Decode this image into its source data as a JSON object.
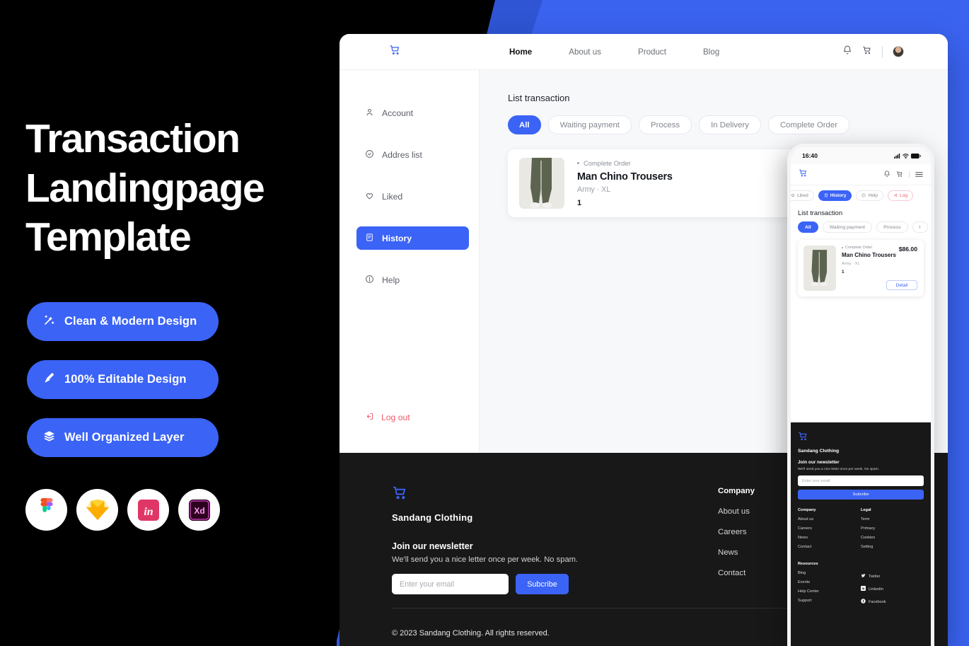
{
  "promo": {
    "title": "Transaction Landingpage Template",
    "badges": [
      {
        "label": "Clean & Modern  Design",
        "icon": "magic-wand-icon"
      },
      {
        "label": "100% Editable Design",
        "icon": "pen-nib-icon"
      },
      {
        "label": "Well Organized Layer",
        "icon": "layers-icon"
      }
    ],
    "apps": [
      {
        "name": "figma-icon",
        "label": "Figma"
      },
      {
        "name": "sketch-icon",
        "label": "Sketch"
      },
      {
        "name": "invision-icon",
        "label": "InVision"
      },
      {
        "name": "adobe-xd-icon",
        "label": "Xd"
      }
    ]
  },
  "colors": {
    "accent": "#3b63f6",
    "bg_blue_bright": "#3a63f0",
    "bg_blue_dark": "#2f55d4",
    "footer_dark": "#181818",
    "danger": "#ef5a6a"
  },
  "desktop": {
    "navbar": {
      "logo": "shopping-cart-icon",
      "links": [
        {
          "label": "Home",
          "active": true
        },
        {
          "label": "About us",
          "active": false
        },
        {
          "label": "Product",
          "active": false
        },
        {
          "label": "Blog",
          "active": false
        }
      ],
      "bell": "bell-icon",
      "cart": "cart-icon",
      "avatar": "user-avatar"
    },
    "sidebar": {
      "items": [
        {
          "label": "Account",
          "icon": "user-icon",
          "active": false
        },
        {
          "label": "Addres list",
          "icon": "check-circle-icon",
          "active": false
        },
        {
          "label": "Liked",
          "icon": "heart-icon",
          "active": false
        },
        {
          "label": "History",
          "icon": "receipt-icon",
          "active": true
        },
        {
          "label": "Help",
          "icon": "info-circle-icon",
          "active": false
        }
      ],
      "logout": "Log out"
    },
    "main": {
      "title": "List transaction",
      "filters": [
        {
          "label": "All",
          "active": true
        },
        {
          "label": "Waiting payment",
          "active": false
        },
        {
          "label": "Process",
          "active": false
        },
        {
          "label": "In Delivery",
          "active": false
        },
        {
          "label": "Complete Order",
          "active": false
        }
      ],
      "transaction": {
        "status": "Complete Order",
        "name": "Man Chino Trousers",
        "variant": "Army · XL",
        "quantity": "1"
      }
    },
    "footer": {
      "logo": "shopping-cart-icon",
      "brand": "Sandang Clothing",
      "newsletter_title": "Join our newsletter",
      "newsletter_sub": "We'll send you a nice letter once per week. No spam.",
      "email_placeholder": "Enter your email",
      "subscribe_label": "Subcribe",
      "column": {
        "heading": "Company",
        "links": [
          "About us",
          "Careers",
          "News",
          "Contact"
        ]
      },
      "copyright": "© 2023 Sandang Clothing. All rights reserved."
    }
  },
  "phone": {
    "status_bar": {
      "time": "16:40",
      "signal": "signal-icon",
      "wifi": "wifi-icon",
      "battery": "battery-icon"
    },
    "navbar": {
      "logo": "shopping-cart-icon",
      "bell": "bell-icon",
      "cart": "cart-icon",
      "menu": "hamburger-menu-icon"
    },
    "nav_chips": [
      {
        "label": "Liked",
        "icon": "heart-icon",
        "active": false,
        "danger": false
      },
      {
        "label": "History",
        "icon": "receipt-icon",
        "active": true,
        "danger": false
      },
      {
        "label": "Help",
        "icon": "info-circle-icon",
        "active": false,
        "danger": false
      },
      {
        "label": "Log",
        "icon": "logout-icon",
        "active": false,
        "danger": true
      }
    ],
    "main": {
      "title": "List transaction",
      "filters": [
        {
          "label": "All",
          "active": true
        },
        {
          "label": "Waiting payment",
          "active": false
        },
        {
          "label": "Process",
          "active": false
        },
        {
          "label": "I",
          "active": false
        }
      ],
      "transaction": {
        "status": "Complete Order",
        "name": "Man Chino Trousers",
        "variant": "Army · XL",
        "quantity": "1",
        "price": "$86.00",
        "detail_label": "Detail"
      }
    },
    "footer": {
      "logo": "shopping-cart-icon",
      "brand": "Sandang Clothing",
      "newsletter_title": "Join our newsletter",
      "newsletter_sub": "We'll send you a nice letter once per week. No spam.",
      "email_placeholder": "Enter your email",
      "subscribe_label": "Subcribe",
      "company": {
        "heading": "Company",
        "links": [
          "About us",
          "Careers",
          "News",
          "Contact"
        ]
      },
      "legal": {
        "heading": "Legal",
        "links": [
          "Term",
          "Primacy",
          "Cookies",
          "Setting"
        ]
      },
      "resources": {
        "heading": "Resources",
        "links": [
          "Blog",
          "Events",
          "Help Center",
          "Support"
        ]
      },
      "social": [
        {
          "label": "Twitter",
          "icon": "twitter-icon"
        },
        {
          "label": "Linkedin",
          "icon": "linkedin-icon"
        },
        {
          "label": "Facebook",
          "icon": "facebook-icon"
        }
      ]
    }
  }
}
